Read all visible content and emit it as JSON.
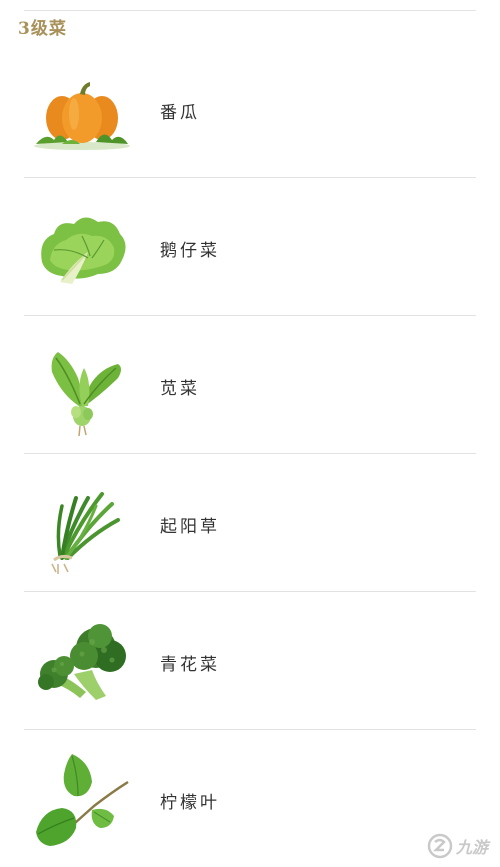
{
  "section": {
    "title": "3级菜"
  },
  "items": [
    {
      "label": "番瓜",
      "icon": "pumpkin-icon"
    },
    {
      "label": "鹅仔菜",
      "icon": "lettuce-icon"
    },
    {
      "label": "苋菜",
      "icon": "amaranth-icon"
    },
    {
      "label": "起阳草",
      "icon": "chive-icon"
    },
    {
      "label": "青花菜",
      "icon": "broccoli-icon"
    },
    {
      "label": "柠檬叶",
      "icon": "lemon-leaf-icon"
    }
  ],
  "watermark": {
    "text": "九游",
    "icon": "jiuyou-logo-icon"
  }
}
